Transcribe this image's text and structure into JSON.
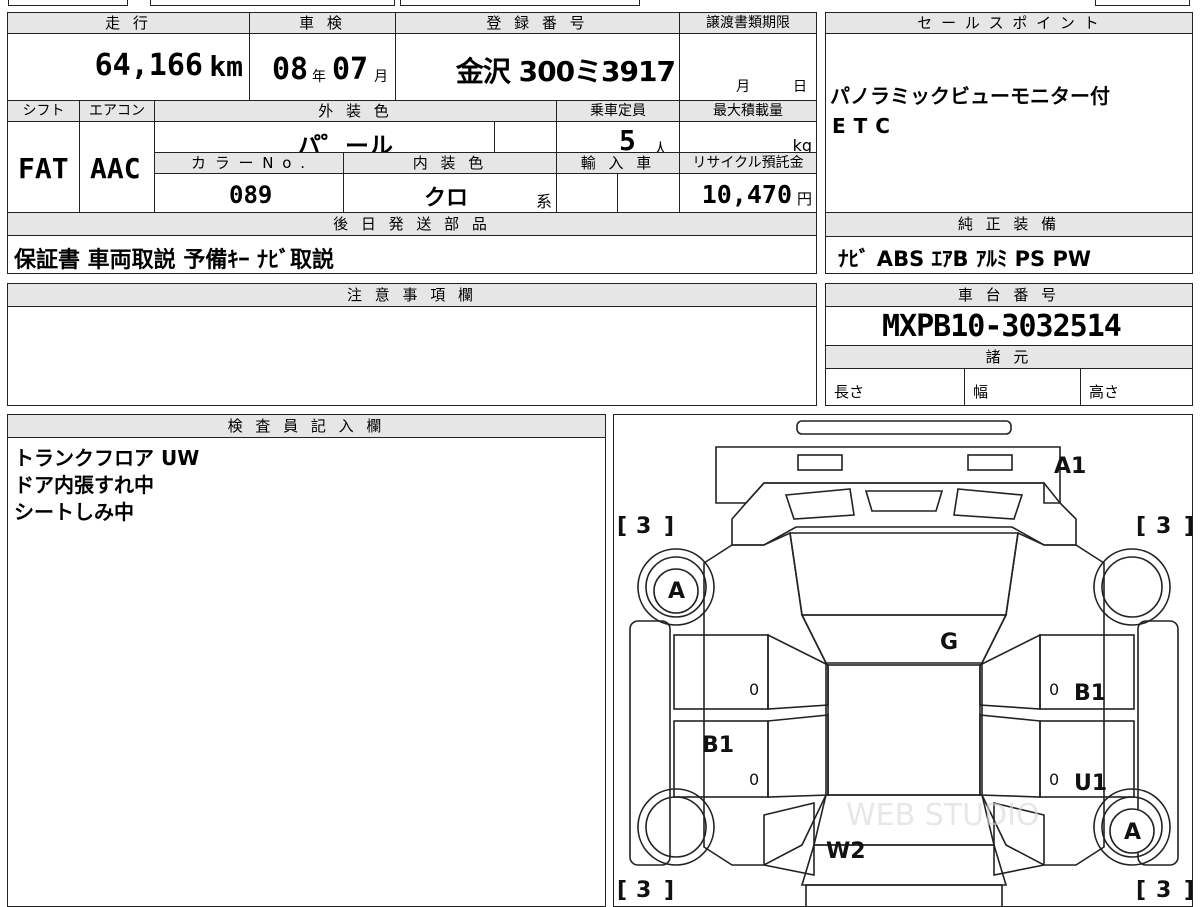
{
  "top_table": {
    "mileage_header": "走 行",
    "mileage_value": "64,166",
    "mileage_unit": "km",
    "inspection_header": "車 検",
    "inspection_year": "08",
    "inspection_year_unit": "年",
    "inspection_month": "07",
    "inspection_month_unit": "月",
    "registration_header": "登 録 番 号",
    "registration_value": "金沢 300ミ3917",
    "transfer_deadline_header": "譲渡書類期限",
    "transfer_month_unit": "月",
    "transfer_day_unit": "日",
    "shift_header": "シフト",
    "shift_value": "FAT",
    "aircon_header": "エアコン",
    "aircon_value": "AAC",
    "exterior_color_header": "外 装 色",
    "exterior_color_value": "パ゜ール",
    "capacity_header": "乗車定員",
    "capacity_value": "5",
    "capacity_unit": "人",
    "max_load_header": "最大積載量",
    "max_load_unit": "kg",
    "color_no_header": "カ ラ ー N o .",
    "color_no_value": "089",
    "interior_color_header": "内 装 色",
    "interior_color_value": "クロ",
    "interior_color_suffix": "系",
    "import_header": "輸 入 車",
    "recycle_header": "リサイクル預託金",
    "recycle_value": "10,470",
    "recycle_unit": "円",
    "later_parts_header": "後 日 発 送 部 品",
    "later_parts_value": "保証書 車両取説 予備ｷｰ ﾅﾋﾞ取説"
  },
  "sales_points": {
    "header": "セ ー ル ス ポ イ ン ト",
    "lines": [
      "パノラミックビューモニター付",
      "ETC"
    ]
  },
  "standard_equipment": {
    "header": "純 正 装 備",
    "value": "ﾅﾋﾞ ABS ｴｱB ｱﾙﾐ PS PW"
  },
  "notes": {
    "header": "注 意 事 項 欄"
  },
  "chassis": {
    "header": "車 台 番 号",
    "value": "MXPB10-3032514",
    "specs_header": "諸 元",
    "length_label": "長さ",
    "width_label": "幅",
    "height_label": "高さ"
  },
  "inspector": {
    "header": "検 査 員 記 入 欄",
    "lines": [
      "トランクフロア UW",
      "ドア内張すれ中",
      "シートしみ中"
    ]
  },
  "diagram": {
    "marks": {
      "a1": "A1",
      "g": "G",
      "a_front_left": "A",
      "a_rear_right": "A",
      "b1_right": "B1",
      "b1_left": "B1",
      "u1": "U1",
      "w2": "W2",
      "zero1": "0",
      "zero2": "0",
      "zero3": "0",
      "zero4": "0"
    },
    "tire_label": "3",
    "watermark": "WEB STUDIO"
  }
}
